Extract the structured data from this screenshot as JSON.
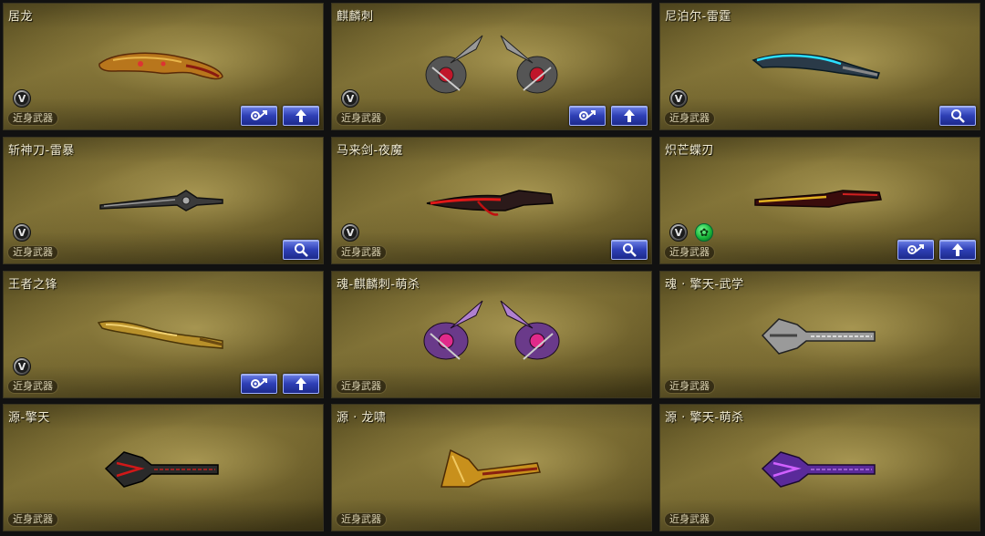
{
  "cards": [
    {
      "name": "居龙",
      "category": "近身武器",
      "badges": [
        "v"
      ],
      "buttons": [
        "upgrade",
        "wrench"
      ]
    },
    {
      "name": "麒麟刺",
      "category": "近身武器",
      "badges": [
        "v"
      ],
      "buttons": [
        "upgrade",
        "wrench"
      ]
    },
    {
      "name": "尼泊尔-雷霆",
      "category": "近身武器",
      "badges": [
        "v"
      ],
      "buttons": [
        "search"
      ]
    },
    {
      "name": "斩神刀-雷暴",
      "category": "近身武器",
      "badges": [
        "v"
      ],
      "buttons": [
        "search"
      ]
    },
    {
      "name": "马来剑-夜魔",
      "category": "近身武器",
      "badges": [
        "v"
      ],
      "buttons": [
        "search"
      ]
    },
    {
      "name": "炽芒蝶刃",
      "category": "近身武器",
      "badges": [
        "v",
        "green"
      ],
      "buttons": [
        "upgrade",
        "wrench"
      ]
    },
    {
      "name": "王者之锋",
      "category": "近身武器",
      "badges": [
        "v"
      ],
      "buttons": [
        "upgrade",
        "wrench"
      ]
    },
    {
      "name": "魂-麒麟刺-萌杀",
      "category": "近身武器",
      "badges": [],
      "buttons": []
    },
    {
      "name": "魂 · 擎天-武学",
      "category": "近身武器",
      "badges": [],
      "buttons": []
    },
    {
      "name": "源-擎天",
      "category": "近身武器",
      "badges": [],
      "buttons": []
    },
    {
      "name": "源 · 龙啸",
      "category": "近身武器",
      "badges": [],
      "buttons": []
    },
    {
      "name": "源 · 擎天-萌杀",
      "category": "近身武器",
      "badges": [],
      "buttons": []
    }
  ],
  "badge_labels": {
    "v": "V"
  },
  "colors": {
    "button_blue": "#2e3fb5",
    "card_gold": "#7d6f35",
    "green_badge": "#18b83a"
  }
}
